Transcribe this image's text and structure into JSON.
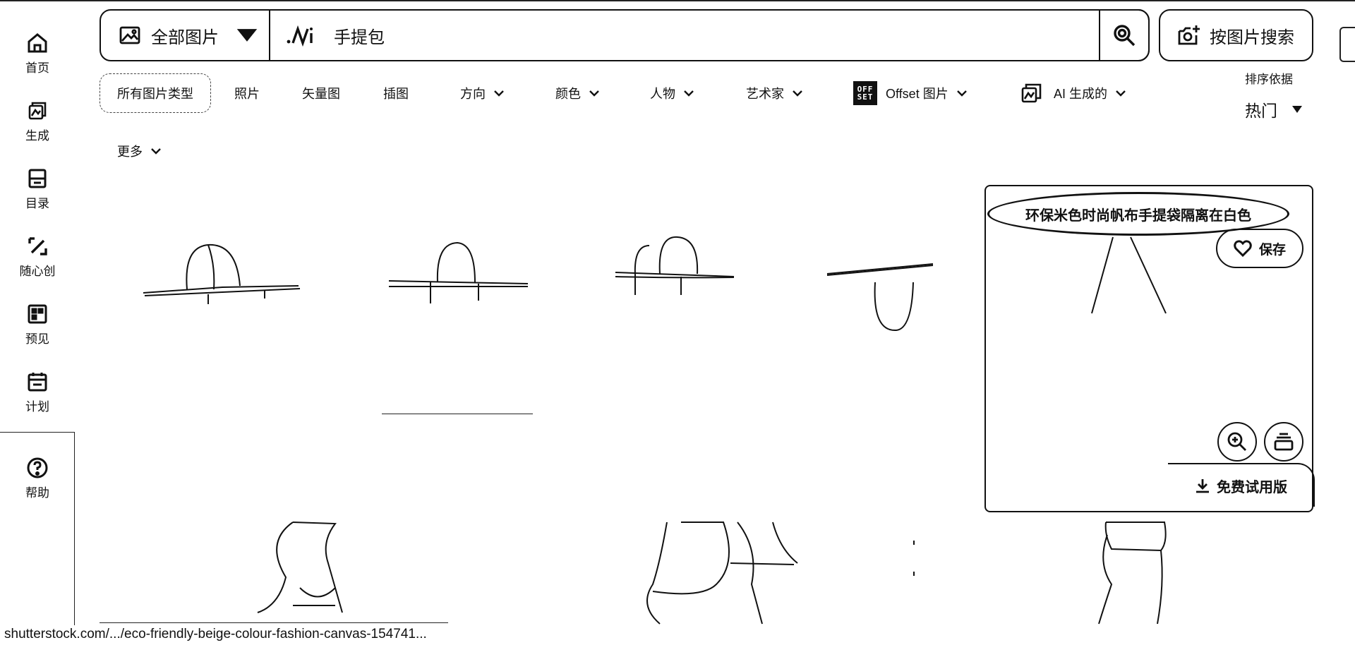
{
  "sidebar": {
    "items": [
      {
        "label": "首页",
        "icon": "home-icon"
      },
      {
        "label": "生成",
        "icon": "generate-icon"
      },
      {
        "label": "目录",
        "icon": "catalog-icon"
      },
      {
        "label": "随心创",
        "icon": "create-icon"
      },
      {
        "label": "预见",
        "icon": "preview-icon"
      },
      {
        "label": "计划",
        "icon": "plan-icon"
      },
      {
        "label": "帮助",
        "icon": "help-icon"
      }
    ]
  },
  "search": {
    "scope_label": "全部图片",
    "query": "手提包",
    "image_search_label": "按图片搜索"
  },
  "filters": {
    "image_type": "所有图片类型",
    "photo": "照片",
    "vector": "矢量图",
    "illustration": "插图",
    "orientation": "方向",
    "color": "颜色",
    "people": "人物",
    "artist": "艺术家",
    "offset_logo_top": "OFF",
    "offset_logo_bottom": "SET",
    "offset": "Offset 图片",
    "ai_generated": "AI 生成的",
    "more": "更多"
  },
  "sort": {
    "label": "排序依据",
    "value": "热门"
  },
  "card": {
    "title": "环保米色时尚帆布手提袋隔离在白色",
    "save_label": "保存",
    "free_trial_label": "免费试用版"
  },
  "status_url": "shutterstock.com/.../eco-friendly-beige-colour-fashion-canvas-154741..."
}
